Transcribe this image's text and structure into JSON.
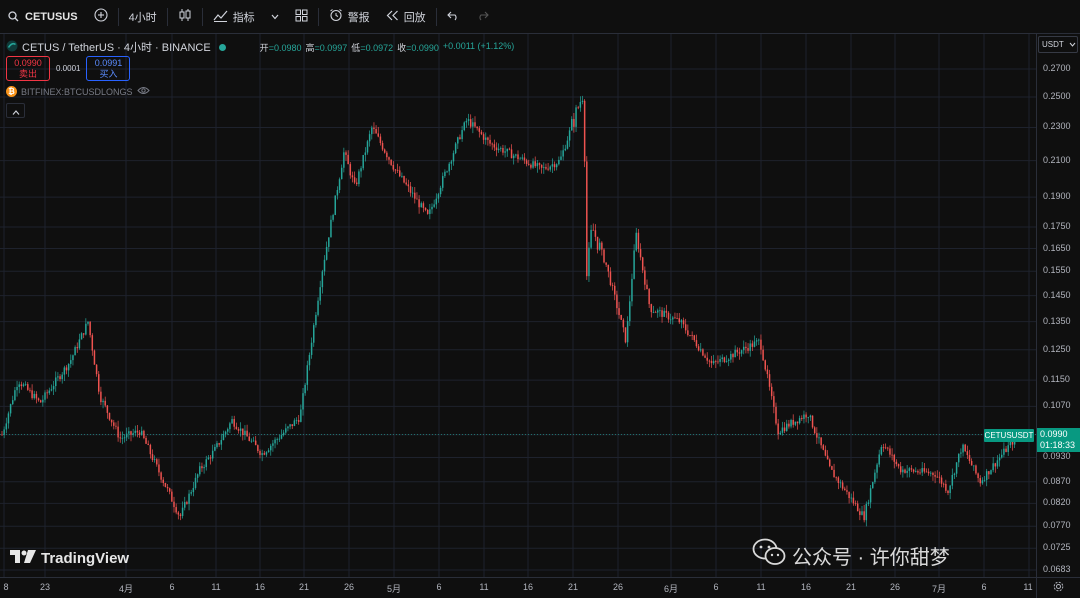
{
  "toolbar": {
    "symbol": "CETUSUS",
    "interval": "4小时",
    "indicators_label": "指标",
    "alert_label": "警报",
    "replay_label": "回放"
  },
  "legend": {
    "title": "CETUS / TetherUS · 4小时 · BINANCE",
    "open_label": "开",
    "open": "=0.0980",
    "high_label": "高",
    "high": "=0.0997",
    "low_label": "低",
    "low": "=0.0972",
    "close_label": "收",
    "close": "=0.0990",
    "change": "+0.0011 (+1.12%)"
  },
  "trade": {
    "sell_price": "0.0990",
    "sell_label": "卖出",
    "spread": "0.0001",
    "buy_price": "0.0991",
    "buy_label": "买入"
  },
  "indicator": {
    "name": "BITFINEX:BTCUSDLONGS",
    "icon": "bitcoin-icon"
  },
  "currency_select": "USDT",
  "current_price": {
    "symbol": "CETUSUSDT",
    "price": "0.0990",
    "countdown": "01:18:33"
  },
  "price_axis": [
    "0.2700",
    "0.2500",
    "0.2300",
    "0.2100",
    "0.1900",
    "0.1750",
    "0.1650",
    "0.1550",
    "0.1450",
    "0.1350",
    "0.1250",
    "0.1150",
    "0.1070",
    "0.0990",
    "0.0930",
    "0.0870",
    "0.0820",
    "0.0770",
    "0.0725",
    "0.0683"
  ],
  "time_axis": [
    "8",
    "23",
    "4月",
    "6",
    "11",
    "16",
    "21",
    "26",
    "5月",
    "6",
    "11",
    "16",
    "21",
    "26",
    "6月",
    "6",
    "11",
    "16",
    "21",
    "26",
    "7月",
    "6",
    "11"
  ],
  "brand": "TradingView",
  "watermark": "公众号 · 许你甜梦",
  "colors": {
    "up": "#26a69a",
    "down": "#ef5350",
    "background": "#0f0f0f",
    "grid": "#1e222d",
    "accent": "#089981"
  },
  "chart_data": {
    "type": "candlestick",
    "symbol": "CETUS/USDT",
    "timeframe": "4小时",
    "scale": "log",
    "grid": true,
    "path": [
      {
        "x": "3月8",
        "y": 0.099
      },
      {
        "x": "3月10",
        "y": 0.115
      },
      {
        "x": "3月14",
        "y": 0.108
      },
      {
        "x": "3月20",
        "y": 0.121
      },
      {
        "x": "3月25",
        "y": 0.135
      },
      {
        "x": "3月29",
        "y": 0.11
      },
      {
        "x": "4月1",
        "y": 0.098
      },
      {
        "x": "4月4",
        "y": 0.1
      },
      {
        "x": "4月6",
        "y": 0.079
      },
      {
        "x": "4月8",
        "y": 0.09
      },
      {
        "x": "4月11",
        "y": 0.095
      },
      {
        "x": "4月14",
        "y": 0.103
      },
      {
        "x": "4月17",
        "y": 0.094
      },
      {
        "x": "4月21",
        "y": 0.104
      },
      {
        "x": "4月23",
        "y": 0.155
      },
      {
        "x": "4月25",
        "y": 0.215
      },
      {
        "x": "4月28",
        "y": 0.195
      },
      {
        "x": "4月30",
        "y": 0.23
      },
      {
        "x": "5月3",
        "y": 0.205
      },
      {
        "x": "5月6",
        "y": 0.18
      },
      {
        "x": "5月9",
        "y": 0.225
      },
      {
        "x": "5月11",
        "y": 0.235
      },
      {
        "x": "5月14",
        "y": 0.22
      },
      {
        "x": "5月17",
        "y": 0.205
      },
      {
        "x": "5月20",
        "y": 0.21
      },
      {
        "x": "5月22",
        "y": 0.255
      },
      {
        "x": "5月23",
        "y": 0.15
      },
      {
        "x": "5月24",
        "y": 0.175
      },
      {
        "x": "5月27",
        "y": 0.158
      },
      {
        "x": "5月30",
        "y": 0.128
      },
      {
        "x": "6月2",
        "y": 0.172
      },
      {
        "x": "6月4",
        "y": 0.14
      },
      {
        "x": "6月7",
        "y": 0.135
      },
      {
        "x": "6月10",
        "y": 0.12
      },
      {
        "x": "6月13",
        "y": 0.128
      },
      {
        "x": "6月15",
        "y": 0.1
      },
      {
        "x": "6月17",
        "y": 0.105
      },
      {
        "x": "6月19",
        "y": 0.09
      },
      {
        "x": "6月22",
        "y": 0.079
      },
      {
        "x": "6月24",
        "y": 0.097
      },
      {
        "x": "6月27",
        "y": 0.09
      },
      {
        "x": "7月1",
        "y": 0.089
      },
      {
        "x": "7月3",
        "y": 0.085
      },
      {
        "x": "7月5",
        "y": 0.096
      },
      {
        "x": "7月8",
        "y": 0.087
      },
      {
        "x": "7月11",
        "y": 0.099
      }
    ]
  }
}
